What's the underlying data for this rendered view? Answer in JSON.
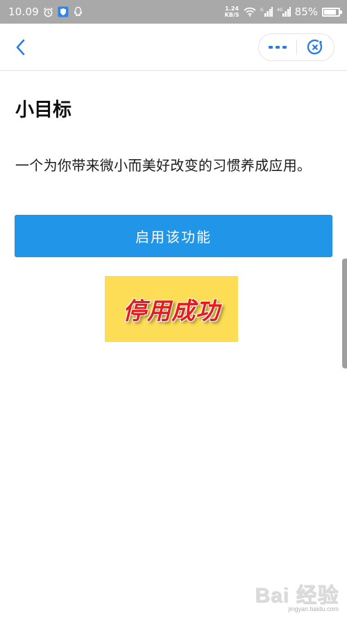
{
  "status_bar": {
    "time": "10.09",
    "net_speed_value": "1.24",
    "net_speed_unit": "KB/S",
    "battery_percent": "85%",
    "battery_level": 0.85,
    "icons": [
      "alarm-icon",
      "shield-icon",
      "qq-icon",
      "wifi-icon",
      "signal-icon",
      "signal-4g-icon",
      "battery-icon"
    ]
  },
  "nav": {
    "back_icon": "chevron-left-icon",
    "more_icon": "more-dots-icon",
    "close_icon": "close-target-icon",
    "accent_color": "#2a7de1"
  },
  "main": {
    "title": "小目标",
    "description": "一个为你带来微小而美好改变的习惯养成应用。",
    "enable_button_label": "启用该功能",
    "enable_button_color": "#2196e8",
    "success_text": "停用成功",
    "success_bg_color": "#fddd55",
    "success_text_color": "#e31d1d"
  },
  "watermark": {
    "logo": "Bai 经验",
    "url": "jingyan.baidu.com"
  }
}
